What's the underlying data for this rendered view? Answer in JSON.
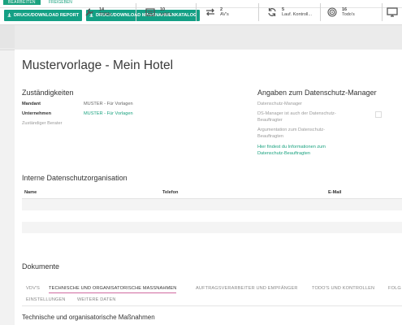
{
  "top_tabs": {
    "edit": "BEARBEITEN",
    "release": "FREIGEBEN"
  },
  "actions": {
    "report": "DRUCK/DOWNLOAD REPORT",
    "catalog": "DRUCK/DOWNLOAD MASSNAHMENKATALOG"
  },
  "stats": [
    {
      "icon": "tools-icon",
      "count": "14",
      "label": "TOMs"
    },
    {
      "icon": "list-icon",
      "count": "10",
      "label": "VdV's"
    },
    {
      "icon": "transfer-icon",
      "count": "2",
      "label": "AV's"
    },
    {
      "icon": "sync-icon",
      "count": "5",
      "label": "Lauf. Kontroll..."
    },
    {
      "icon": "target-icon",
      "count": "16",
      "label": "Todo's"
    }
  ],
  "page_title": "Mustervorlage - Mein Hotel",
  "responsibilities": {
    "heading": "Zuständigkeiten",
    "client_label": "Mandant",
    "client_value": "MUSTER - Für Vorlagen",
    "company_label": "Unternehmen",
    "company_value": "MUSTER - Für Vorlagen",
    "advisor_label": "Zuständiger Berater"
  },
  "dpo": {
    "heading": "Angaben zum Datenschutz-Manager",
    "manager_label": "Datenschutz-Manager",
    "is_rep_label_1": "DS-Manager ist auch der Datenschutz-",
    "is_rep_label_2": "Beauftragter",
    "argument_label_1": "Argumentation zum Datenschutz-",
    "argument_label_2": "Beauftragten",
    "info_link_1": "Hier findest du Informationen zum",
    "info_link_2": "Datenschutz-Beauftragten"
  },
  "internal_org": {
    "heading": "Interne Datenschutzorganisation",
    "columns": [
      "Name",
      "Telefon",
      "E-Mail"
    ]
  },
  "documents": {
    "heading": "Dokumente",
    "tabs": [
      "VDV'S",
      "TECHNISCHE UND ORGANISATORISCHE MASSNAHMEN",
      "AUFTRAGSVERARBEITER UND EMPFÄNGER",
      "TODO'S UND KONTROLLEN",
      "FOLG",
      "EINSTELLUNGEN",
      "WEITERE DATEN"
    ],
    "active_tab_index": 1,
    "section_title": "Technische und organisatorische Maßnahmen"
  },
  "colors": {
    "accent": "#1aa27f",
    "active_tab_underline": "#d06aa0"
  }
}
